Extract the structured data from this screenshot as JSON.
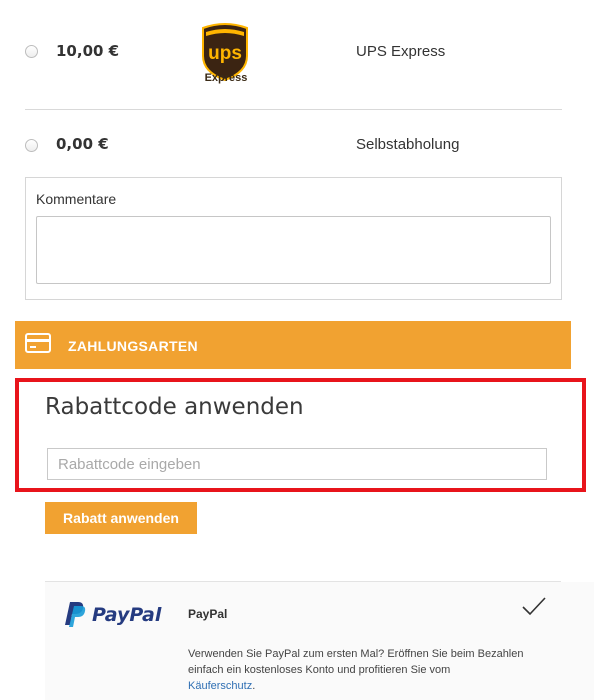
{
  "shipping": {
    "options": [
      {
        "price": "10,00 €",
        "name": "UPS Express",
        "logo_text": "ups",
        "logo_sub": "Express"
      },
      {
        "price": "0,00 €",
        "name": "Selbstabholung"
      }
    ]
  },
  "comments": {
    "label": "Kommentare",
    "value": ""
  },
  "payment_bar": {
    "label": "ZAHLUNGSARTEN",
    "color": "#f1a231"
  },
  "discount": {
    "title": "Rabattcode anwenden",
    "placeholder": "Rabattcode eingeben",
    "button_label": "Rabatt anwenden",
    "highlight_color": "#e8141b"
  },
  "paypal": {
    "logo_text": "PayPal",
    "name": "PayPal",
    "selected": true,
    "description": "Verwenden Sie PayPal zum ersten Mal? Eröffnen Sie beim Bezahlen einfach ein kostenloses Konto und profitieren Sie vom",
    "link_text": "Käuferschutz",
    "description_end": "."
  }
}
